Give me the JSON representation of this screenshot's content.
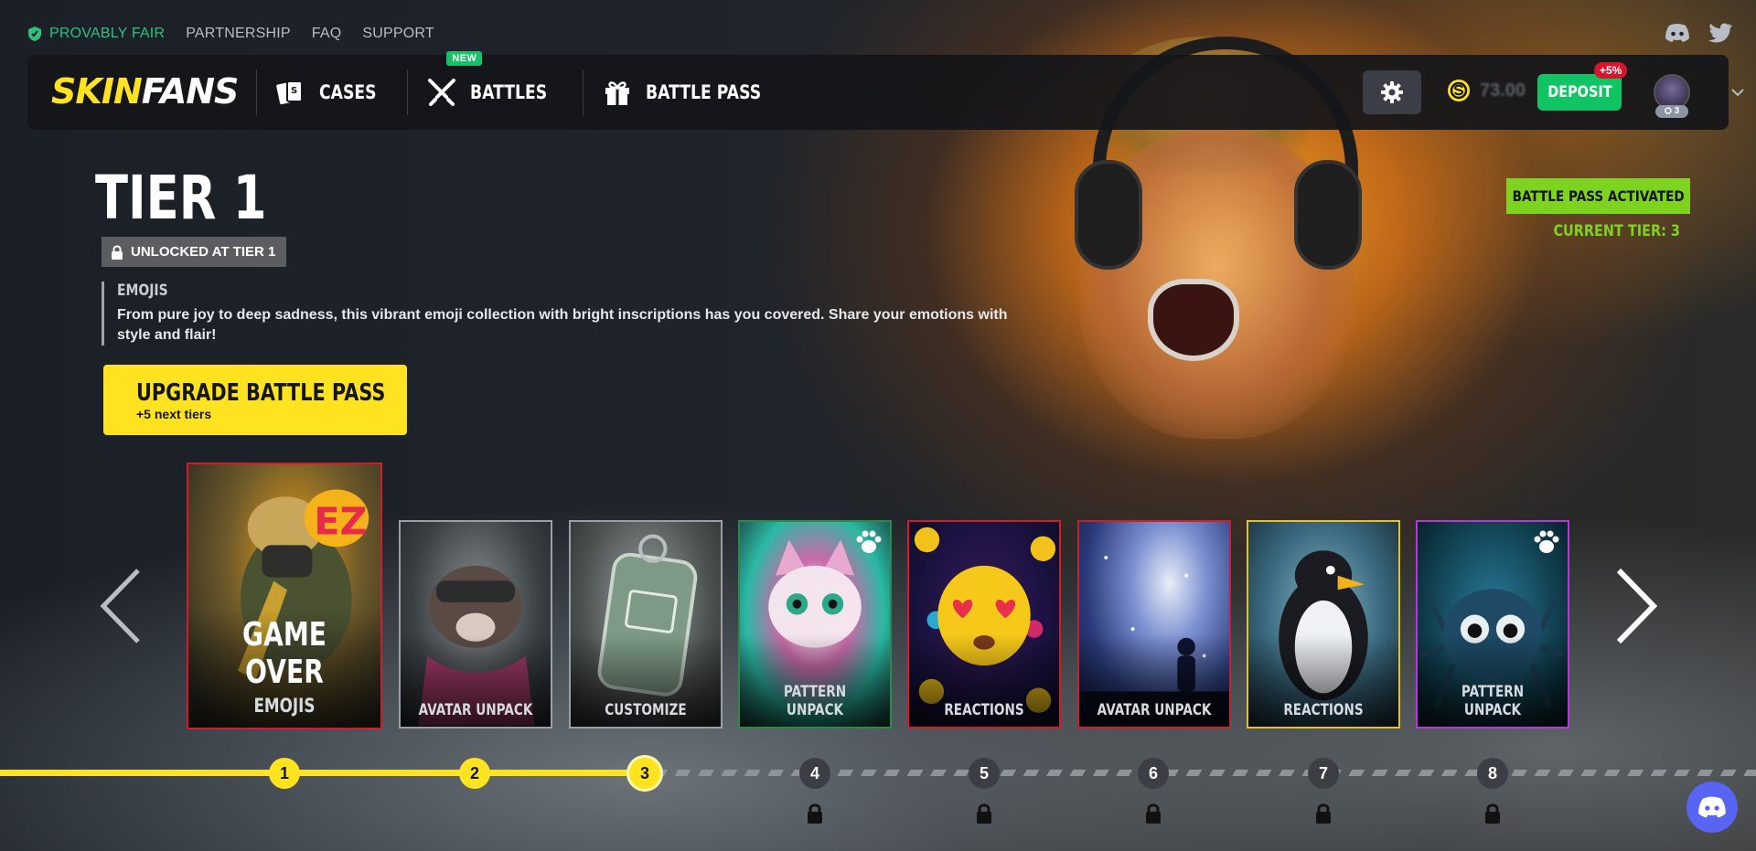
{
  "topstrip": {
    "provably_fair": "PROVABLY FAIR",
    "links": [
      "PARTNERSHIP",
      "FAQ",
      "SUPPORT"
    ]
  },
  "header": {
    "logo_part1": "SKIN",
    "logo_part2": "FANS",
    "nav": [
      {
        "label": "CASES",
        "icon": "cards-icon"
      },
      {
        "label": "BATTLES",
        "icon": "crossed-swords-icon",
        "badge": "NEW"
      },
      {
        "label": "BATTLE PASS",
        "icon": "gift-icon"
      }
    ],
    "balance": "73.00",
    "deposit_label": "DEPOSIT",
    "deposit_bonus": "+5%",
    "avatar_level": "3"
  },
  "hero": {
    "tier_title": "TIER 1",
    "unlock_tag": "UNLOCKED AT TIER 1",
    "reward_title": "EMOJIS",
    "reward_description": "From pure joy to deep sadness, this vibrant emoji collection with bright inscriptions has you covered. Share your emotions with style and flair!",
    "upgrade_label": "UPGRADE BATTLE PASS",
    "upgrade_sub": "+5 next tiers",
    "status_badge": "BATTLE PASS ACTIVATED",
    "current_tier": "CURRENT TIER: 3"
  },
  "cards": [
    {
      "title": "GAME OVER",
      "label": "EMOJIS",
      "border": "#d01c2c"
    },
    {
      "label": "AVATAR UNPACK",
      "border": "#9aa0a6"
    },
    {
      "label": "CUSTOMIZE",
      "border": "#9aa0a6"
    },
    {
      "label": "PATTERN UNPACK",
      "border": "#2a8a4a"
    },
    {
      "label": "REACTIONS",
      "border": "#d01c2c"
    },
    {
      "label": "AVATAR UNPACK",
      "border": "#d01c2c"
    },
    {
      "label": "REACTIONS",
      "border": "#e6c21c"
    },
    {
      "label": "PATTERN UNPACK",
      "border": "#b23bd6"
    }
  ],
  "tiers": [
    "1",
    "2",
    "3",
    "4",
    "5",
    "6",
    "7",
    "8"
  ],
  "current_tier_index": 3,
  "colors": {
    "accent_yellow": "#ffe321",
    "green": "#7ed321",
    "deposit_green": "#10c463",
    "fair_green": "#2ec37d"
  }
}
